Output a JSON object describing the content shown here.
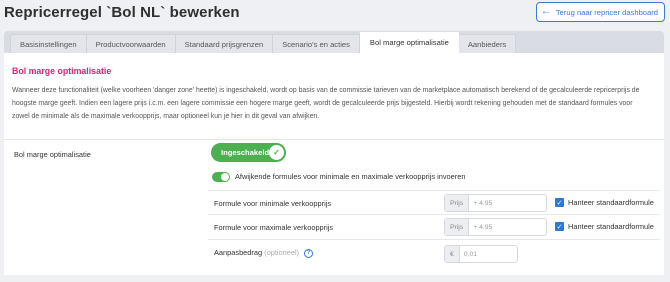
{
  "page": {
    "title": "Repricerregel `Bol NL` bewerken"
  },
  "header": {
    "back_label": "Terug naar repricer dashboard"
  },
  "tabs": [
    {
      "label": "Basisinstellingen"
    },
    {
      "label": "Productvoorwaarden"
    },
    {
      "label": "Standaard prijsgrenzen"
    },
    {
      "label": "Scenario's en acties"
    },
    {
      "label": "Bol marge optimalisatie",
      "active": true
    },
    {
      "label": "Aanbieders"
    }
  ],
  "section": {
    "title": "Bol marge optimalisatie",
    "description": "Wanneer deze functionaliteit (welke voorheen 'danger zone' heette) is ingeschakeld, wordt op basis van de commissie tarieven van de marketplace automatisch berekend of de gecalculeerde repricerprijs de hoogste marge geeft. Indien een lagere prijs i.c.m. een lagere commissie een hogere marge geeft, wordt de gecalculeerde prijs bijgesteld. Hierbij wordt rekening gehouden met de standaard formules voor zowel de minimale als de maximale verkoopprijs, maar optioneel kun je hier in dit geval van afwijken."
  },
  "settings": {
    "label": "Bol marge optimalisatie",
    "toggle_label": "Ingeschakeld",
    "custom_formulas_label": "Afwijkende formules voor minimale en maximale verkoopprijs invoeren",
    "min_price": {
      "label": "Formule voor minimale verkoopprijs",
      "addon": "Prijs",
      "placeholder": "+ 4.95",
      "checkbox_label": "Hanteer standaardformule"
    },
    "max_price": {
      "label": "Formule voor maximale verkoopprijs",
      "addon": "Prijs",
      "placeholder": "+ 4.95",
      "checkbox_label": "Hanteer standaardformule"
    },
    "adjustment": {
      "label": "Aanpasbedrag",
      "optional": "(optioneel)",
      "addon": "€",
      "placeholder": "0,01"
    }
  },
  "colors": {
    "accent": "#3a7bd5",
    "title_pink": "#d6247a",
    "toggle_green": "#4caf50"
  }
}
